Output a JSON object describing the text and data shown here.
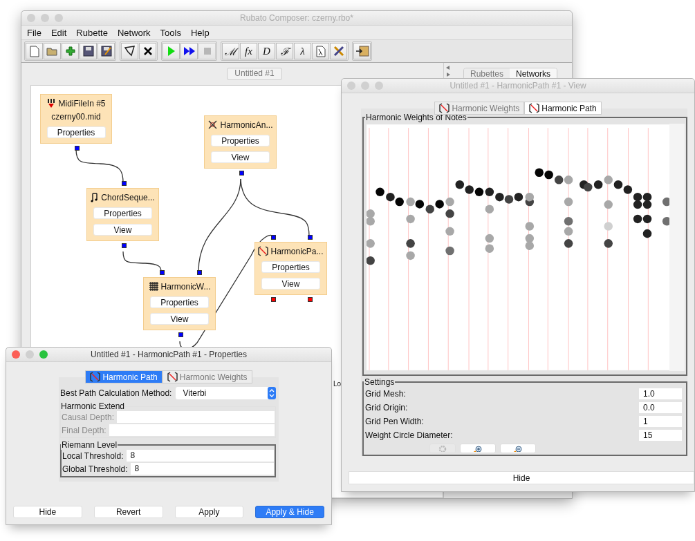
{
  "main_window": {
    "title": "Rubato Composer: czerny.rbo*",
    "active": false,
    "menu": [
      "File",
      "Edit",
      "Rubette",
      "Network",
      "Tools",
      "Help"
    ],
    "toolbar": [
      [
        {
          "kind": "new",
          "disabled": false
        },
        {
          "kind": "open",
          "disabled": false
        },
        {
          "kind": "add",
          "disabled": false
        },
        {
          "kind": "save",
          "disabled": false
        },
        {
          "kind": "save-as",
          "disabled": false
        }
      ],
      [
        {
          "kind": "sketch",
          "disabled": false
        },
        {
          "kind": "delete",
          "disabled": false
        }
      ],
      [
        {
          "kind": "run",
          "disabled": false
        },
        {
          "kind": "run-all",
          "disabled": false
        },
        {
          "kind": "stop",
          "disabled": true
        }
      ],
      [
        {
          "kind": "glyph",
          "glyph": "ℳ",
          "disabled": false
        },
        {
          "kind": "glyph",
          "glyph": "fx",
          "disabled": false
        },
        {
          "kind": "glyph",
          "glyph": "D",
          "disabled": false
        },
        {
          "kind": "glyph",
          "glyph": "ℱ",
          "disabled": false
        },
        {
          "kind": "glyph",
          "glyph": "λ",
          "disabled": false
        },
        {
          "kind": "lambda-page",
          "disabled": false
        },
        {
          "kind": "tools",
          "disabled": false
        }
      ],
      [
        {
          "kind": "exit",
          "disabled": false
        }
      ]
    ],
    "network_tab": "Untitled #1",
    "nodes": [
      {
        "kind": "midi",
        "title": "MidiFileIn #5",
        "subtitle": "czerny00.mid",
        "buttons": [
          "Properties"
        ],
        "outputs": [
          {
            "color": "#0000ff"
          }
        ]
      },
      {
        "kind": "analysis",
        "title": "HarmonicAn...",
        "buttons": [
          "Properties",
          "View"
        ],
        "outputs": [
          {
            "color": "#0000ff"
          }
        ]
      },
      {
        "kind": "chord",
        "title": "ChordSeque...",
        "buttons": [
          "Properties",
          "View"
        ],
        "inputs": [
          {
            "color": "#0000ff"
          }
        ],
        "outputs": [
          {
            "color": "#0000ff"
          }
        ]
      },
      {
        "kind": "path",
        "title": "HarmonicPa...",
        "buttons": [
          "Properties",
          "View"
        ],
        "inputs": [
          {
            "color": "#0000ff"
          },
          {
            "color": "#0000ff"
          }
        ],
        "outputs": [
          {
            "color": "#ff0000"
          },
          {
            "color": "#ff0000"
          }
        ]
      },
      {
        "kind": "weights",
        "title": "HarmonicW...",
        "buttons": [
          "Properties",
          "View"
        ],
        "inputs": [
          {
            "color": "#0000ff"
          },
          {
            "color": "#0000ff"
          }
        ],
        "outputs": [
          {
            "color": "#0000ff"
          }
        ]
      }
    ],
    "panel_tabs": [
      {
        "label": "Rubettes",
        "selected": false
      },
      {
        "label": "Networks",
        "selected": true
      }
    ],
    "partial_label": "Lo"
  },
  "view_window": {
    "title": "Untitled #1 - HarmonicPath #1 - View",
    "active": false,
    "tabs": [
      {
        "label": "Harmonic Weights",
        "selected": false
      },
      {
        "label": "Harmonic Path",
        "selected": true
      }
    ],
    "plot_title": "Harmonic Weights of Notes",
    "settings_title": "Settings",
    "settings": [
      {
        "label": "Grid Mesh:",
        "value": "1.0"
      },
      {
        "label": "Grid Origin:",
        "value": "0.0"
      },
      {
        "label": "Grid Pen Width:",
        "value": "1"
      },
      {
        "label": "Weight Circle Diameter:",
        "value": "15"
      }
    ],
    "tool_buttons": [
      {
        "kind": "gear",
        "disabled": true
      },
      {
        "kind": "zoom-in",
        "disabled": false
      },
      {
        "kind": "zoom-out",
        "disabled": false
      }
    ],
    "hide_button": "Hide"
  },
  "properties_window": {
    "title": "Untitled #1 - HarmonicPath #1 - Properties",
    "active": true,
    "tabs": [
      {
        "label": "Harmonic Path",
        "selected": true
      },
      {
        "label": "Harmonic Weights",
        "selected": false
      }
    ],
    "method": {
      "label": "Best Path Calculation Method:",
      "value": "Viterbi"
    },
    "groups": [
      {
        "title": "Harmonic Extend",
        "disabled": true,
        "fields": [
          {
            "label": "Causal Depth:"
          },
          {
            "label": "Final Depth:"
          }
        ]
      },
      {
        "title": "Riemann Level",
        "disabled": false,
        "fields": [
          {
            "label": "Local Threshold:",
            "value": "8"
          },
          {
            "label": "Global Threshold:",
            "value": "8"
          }
        ]
      }
    ],
    "buttons": [
      {
        "label": "Hide",
        "default": false
      },
      {
        "label": "Revert",
        "default": false
      },
      {
        "label": "Apply",
        "default": false
      },
      {
        "label": "Apply & Hide",
        "default": true
      }
    ]
  }
}
